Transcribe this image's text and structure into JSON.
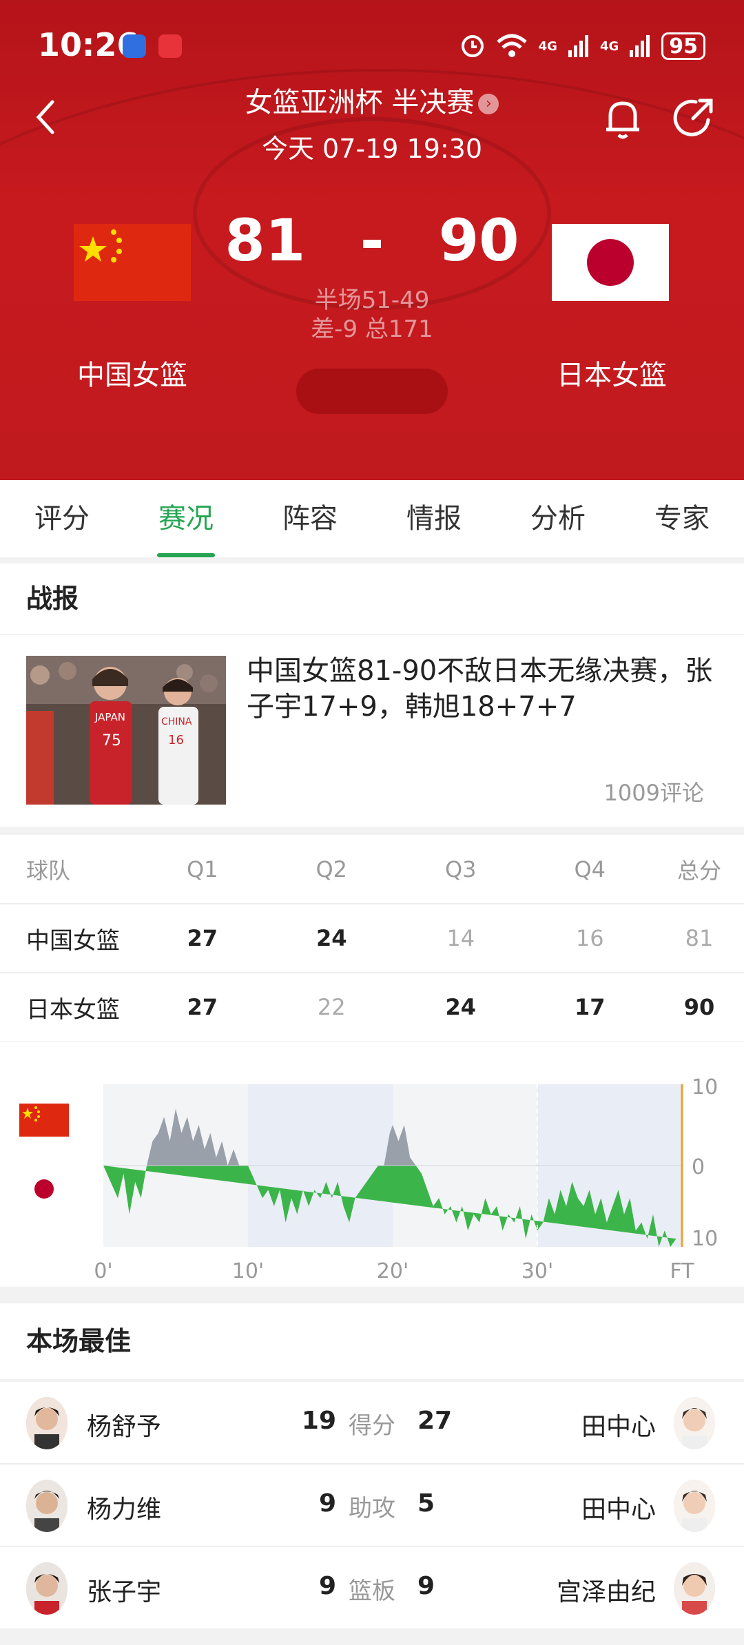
{
  "status_bar": {
    "time": "10:26",
    "battery": "95",
    "net1": "4G",
    "net2": "4G"
  },
  "header": {
    "title": "女篮亚洲杯 半决赛",
    "datetime": "今天 07-19 19:30",
    "home_team": "中国女篮",
    "away_team": "日本女篮",
    "home_score": "81",
    "away_score": "90",
    "score_sep": "-",
    "halftime": "半场51-49",
    "diff_total": "差-9 总171"
  },
  "tabs": [
    "评分",
    "赛况",
    "阵容",
    "情报",
    "分析",
    "专家"
  ],
  "active_tab": 1,
  "report": {
    "section_title": "战报",
    "headline": "中国女篮81-90不敌日本无缘决赛，张子宇17+9，韩旭18+7+7",
    "comments": "1009评论"
  },
  "quarters": {
    "headers": [
      "球队",
      "Q1",
      "Q2",
      "Q3",
      "Q4",
      "总分"
    ],
    "rows": [
      {
        "team": "中国女篮",
        "cells": [
          {
            "v": "27",
            "hi": true
          },
          {
            "v": "24",
            "hi": true
          },
          {
            "v": "14",
            "hi": false
          },
          {
            "v": "16",
            "hi": false
          },
          {
            "v": "81",
            "hi": false
          }
        ]
      },
      {
        "team": "日本女篮",
        "cells": [
          {
            "v": "27",
            "hi": true
          },
          {
            "v": "22",
            "hi": false
          },
          {
            "v": "24",
            "hi": true
          },
          {
            "v": "17",
            "hi": true
          },
          {
            "v": "90",
            "hi": true
          }
        ]
      }
    ]
  },
  "chart_data": {
    "type": "area",
    "title": "",
    "x_tick_labels": [
      "0'",
      "10'",
      "20'",
      "30'",
      "FT"
    ],
    "y_tick_labels": [
      "10",
      "0",
      "10"
    ],
    "ylim": [
      -10,
      10
    ],
    "x_range_minutes": [
      0,
      40
    ],
    "colors": {
      "china_lead": "#9aa0aa",
      "japan_lead": "#3bb54a",
      "band_alt": "#e9edf5",
      "band": "#f3f4f6"
    },
    "x_minutes": [
      0,
      0.5,
      1,
      1.4,
      1.8,
      2.2,
      2.6,
      3,
      3.4,
      3.8,
      4.2,
      4.6,
      5,
      5.4,
      5.8,
      6.2,
      6.6,
      7,
      7.4,
      7.8,
      8.2,
      8.6,
      9,
      9.4,
      9.8,
      10,
      10.5,
      11,
      11.4,
      11.8,
      12.2,
      12.6,
      13,
      13.4,
      13.8,
      14.2,
      14.6,
      15,
      15.4,
      15.8,
      16.2,
      16.6,
      17,
      17.4,
      17.8,
      18.2,
      18.6,
      19,
      19.4,
      19.8,
      20,
      20.4,
      20.8,
      21.2,
      21.6,
      22,
      22.4,
      22.8,
      23.2,
      23.6,
      24,
      24.4,
      24.8,
      25.2,
      25.6,
      26,
      26.4,
      26.8,
      27.2,
      27.6,
      28,
      28.4,
      28.8,
      29.2,
      29.6,
      30,
      30.4,
      30.8,
      31.2,
      31.6,
      32,
      32.4,
      32.8,
      33.2,
      33.6,
      34,
      34.4,
      34.8,
      35.2,
      35.6,
      36,
      36.4,
      36.8,
      37.2,
      37.6,
      38,
      38.4,
      38.8,
      39.2,
      39.6,
      40
    ],
    "margin_china": [
      0,
      -2,
      -4,
      -1,
      -6,
      -2,
      -4,
      0,
      3,
      4,
      6,
      3,
      7,
      4,
      6,
      3,
      5,
      2,
      4,
      1,
      3,
      0,
      2,
      0,
      0,
      0,
      -2,
      -4,
      -3,
      -5,
      -3,
      -7,
      -4,
      -6,
      -3,
      -5,
      -3,
      -4,
      -2,
      -4,
      -2,
      -5,
      -7,
      -4,
      -3,
      -2,
      -1,
      0,
      0,
      4,
      5,
      3,
      5,
      1,
      0,
      -1,
      -3,
      -5,
      -4,
      -6,
      -5,
      -7,
      -5,
      -8,
      -6,
      -7,
      -4,
      -6,
      -5,
      -8,
      -6,
      -7,
      -5,
      -9,
      -6,
      -8,
      -7,
      -4,
      -6,
      -3,
      -5,
      -2,
      -4,
      -5,
      -3,
      -6,
      -4,
      -7,
      -5,
      -3,
      -6,
      -4,
      -8,
      -7,
      -9,
      -6,
      -10,
      -8,
      -10,
      -9
    ]
  },
  "best": {
    "section_title": "本场最佳",
    "rows": [
      {
        "left_name": "杨舒予",
        "left_val": "19",
        "stat": "得分",
        "right_val": "27",
        "right_name": "田中心"
      },
      {
        "left_name": "杨力维",
        "left_val": "9",
        "stat": "助攻",
        "right_val": "5",
        "right_name": "田中心"
      },
      {
        "left_name": "张子宇",
        "left_val": "9",
        "stat": "篮板",
        "right_val": "9",
        "right_name": "宫泽由纪"
      }
    ]
  }
}
